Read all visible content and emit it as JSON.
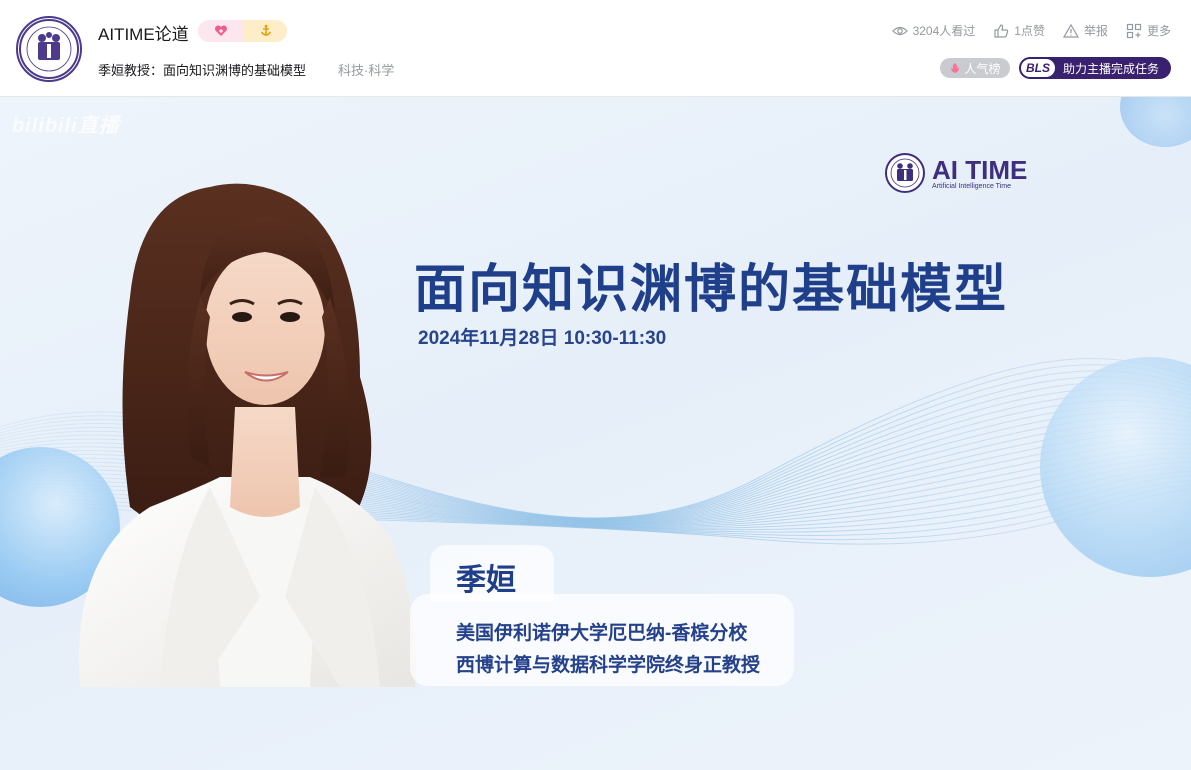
{
  "header": {
    "anchor_name": "AITIME论道",
    "room_title": "季姮教授：面向知识渊博的基础模型",
    "area": "科技·科学",
    "avatar_icon": "aitime-logo-icon",
    "badges": [
      "heart-badge-icon",
      "anchor-badge-icon"
    ],
    "actions": [
      {
        "icon": "eye-icon",
        "label": "3204人看过"
      },
      {
        "icon": "thumb-up-icon",
        "label": "1点赞"
      },
      {
        "icon": "warning-icon",
        "label": "举报"
      },
      {
        "icon": "more-icon",
        "label": "更多"
      }
    ],
    "rank_label": "人气榜",
    "bls_tag": "BLS",
    "bls_label": "助力主播完成任务"
  },
  "video": {
    "watermark": "bilibili直播",
    "brand_main": "AI TIME",
    "brand_sub": "Artificial Intelligence Time",
    "title": "面向知识渊博的基础模型",
    "datetime": "2024年11月28日 10:30-11:30",
    "speaker_name": "季姮",
    "speaker_affiliation_1": "美国伊利诺伊大学厄巴纳-香槟分校",
    "speaker_affiliation_2": "西博计算与数据科学学院终身正教授"
  },
  "colors": {
    "title_blue": "#1f3f8a",
    "brand_purple": "#3d2f7d",
    "bls_bg": "#3a2170",
    "rank_bg": "#c9cbd0"
  }
}
